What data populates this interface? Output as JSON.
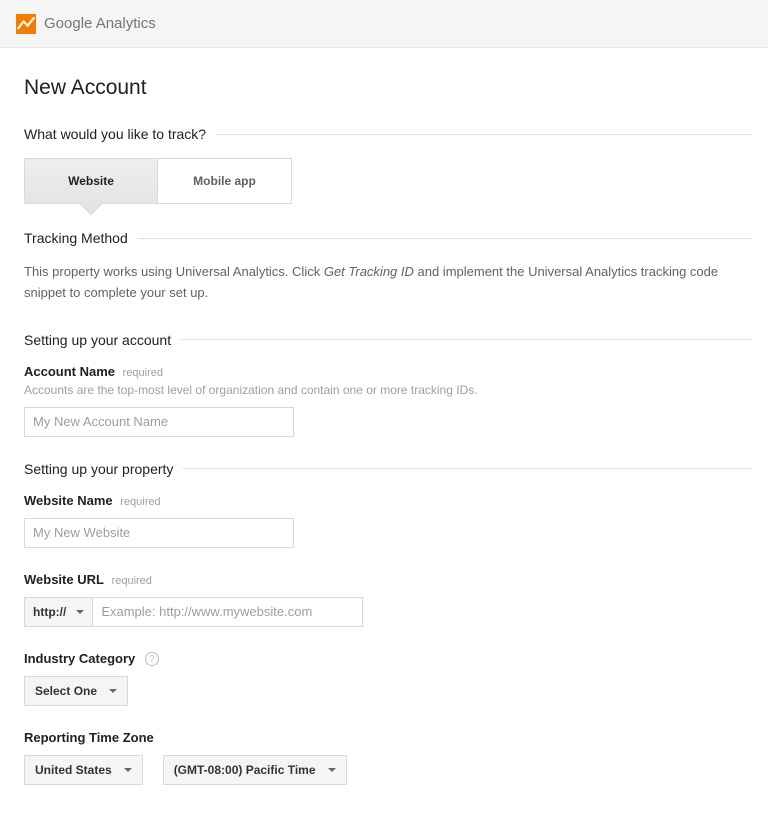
{
  "header": {
    "product_name": "Google Analytics"
  },
  "page": {
    "title": "New Account"
  },
  "track_section": {
    "heading": "What would you like to track?",
    "tabs": {
      "website": "Website",
      "mobile": "Mobile app"
    }
  },
  "method_section": {
    "heading": "Tracking Method",
    "text_before": "This property works using Universal Analytics. Click ",
    "text_italic": "Get Tracking ID",
    "text_after": " and implement the Universal Analytics tracking code snippet to complete your set up."
  },
  "account_section": {
    "heading": "Setting up your account",
    "name_label": "Account Name",
    "name_required": "required",
    "name_hint": "Accounts are the top-most level of organization and contain one or more tracking IDs.",
    "name_placeholder": "My New Account Name"
  },
  "property_section": {
    "heading": "Setting up your property",
    "website_name_label": "Website Name",
    "website_name_required": "required",
    "website_name_placeholder": "My New Website",
    "website_url_label": "Website URL",
    "website_url_required": "required",
    "website_url_protocol": "http://",
    "website_url_placeholder": "Example: http://www.mywebsite.com",
    "industry_label": "Industry Category",
    "industry_value": "Select One",
    "timezone_label": "Reporting Time Zone",
    "timezone_country": "United States",
    "timezone_zone": "(GMT-08:00) Pacific Time"
  }
}
